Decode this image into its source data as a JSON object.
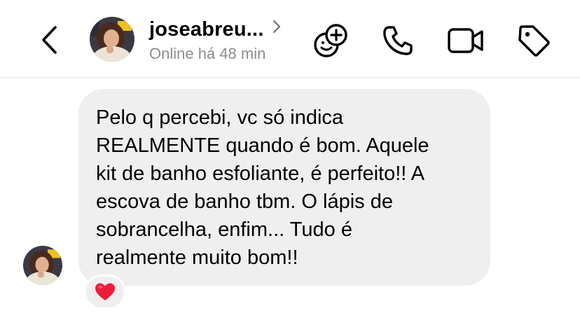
{
  "header": {
    "contact_name": "joseabreu...",
    "status": "Online há 48 min",
    "icons": {
      "back": "chevron-left-icon",
      "profile": "chevron-right-icon",
      "effects": "sticker-add-icon",
      "call": "phone-icon",
      "video": "video-camera-icon",
      "tag": "tag-icon"
    }
  },
  "message": {
    "text": "Pelo q percebi, vc só indica\nREALMENTE quando é bom. Aquele\nkit de banho esfoliante, é perfeito!! A\nescova de banho tbm. O lápis de\nsobrancelha, enfim... Tudo é\nrealmente muito bom!!",
    "reaction": "❤️"
  },
  "colors": {
    "bubble_bg": "#efefef",
    "status_gray": "#8e8e8e",
    "heart_red": "#ed1c3a"
  }
}
